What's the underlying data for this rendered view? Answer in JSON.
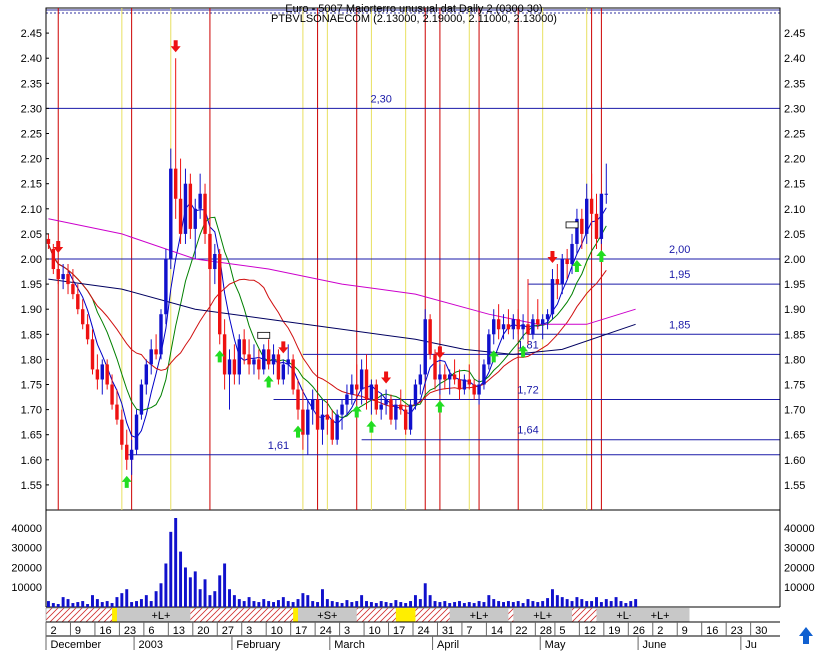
{
  "chart_data": {
    "type": "candlestick",
    "title_line1": "Euro - 5007 Maiorterro unusual dat Dally 2 (0300 30)",
    "title_line2": "PTBVLSONAECOM (2.13000, 2.19000, 2.11000, 2.13000)",
    "price_axis": {
      "min": 1.5,
      "max": 2.5,
      "ticks": [
        "2.45",
        "2.40",
        "2.35",
        "2.30",
        "2.25",
        "2.20",
        "2.15",
        "2.10",
        "2.05",
        "2.00",
        "1.95",
        "1.90",
        "1.85",
        "1.80",
        "1.75",
        "1.70",
        "1.65",
        "1.60",
        "1.55"
      ]
    },
    "volume_axis": {
      "min": 0,
      "max": 45000,
      "ticks": [
        "40000",
        "30000",
        "20000",
        "10000"
      ]
    },
    "x_ticks": [
      {
        "i": 0,
        "label": "2"
      },
      {
        "i": 5,
        "label": "9"
      },
      {
        "i": 10,
        "label": "16"
      },
      {
        "i": 15,
        "label": "23"
      },
      {
        "i": 20,
        "label": "6"
      },
      {
        "i": 25,
        "label": "13"
      },
      {
        "i": 30,
        "label": "20"
      },
      {
        "i": 35,
        "label": "27"
      },
      {
        "i": 40,
        "label": "3"
      },
      {
        "i": 45,
        "label": "10"
      },
      {
        "i": 50,
        "label": "17"
      },
      {
        "i": 55,
        "label": "24"
      },
      {
        "i": 60,
        "label": "3"
      },
      {
        "i": 65,
        "label": "10"
      },
      {
        "i": 70,
        "label": "17"
      },
      {
        "i": 75,
        "label": "24"
      },
      {
        "i": 80,
        "label": "31"
      },
      {
        "i": 85,
        "label": "7"
      },
      {
        "i": 90,
        "label": "14"
      },
      {
        "i": 95,
        "label": "22"
      },
      {
        "i": 100,
        "label": "28"
      },
      {
        "i": 104,
        "label": "5"
      },
      {
        "i": 109,
        "label": "12"
      },
      {
        "i": 114,
        "label": "19"
      },
      {
        "i": 119,
        "label": "26"
      },
      {
        "i": 124,
        "label": "2"
      },
      {
        "i": 129,
        "label": "9"
      },
      {
        "i": 134,
        "label": "16"
      },
      {
        "i": 139,
        "label": "23"
      },
      {
        "i": 144,
        "label": "30"
      }
    ],
    "month_labels": [
      {
        "i": 0,
        "label": "December"
      },
      {
        "i": 18,
        "label": "2003"
      },
      {
        "i": 38,
        "label": "February"
      },
      {
        "i": 58,
        "label": "March"
      },
      {
        "i": 79,
        "label": "April"
      },
      {
        "i": 101,
        "label": "May"
      },
      {
        "i": 121,
        "label": "June"
      },
      {
        "i": 142,
        "label": "Ju"
      }
    ],
    "level_lines": [
      {
        "value": 2.3,
        "label": "2,30",
        "label_i": 68
      },
      {
        "value": 2.0,
        "label": "2,00",
        "label_i": 129,
        "from_i": 0
      },
      {
        "value": 1.95,
        "label": "1,95",
        "label_i": 129,
        "from_i": 98
      },
      {
        "value": 1.85,
        "label": "1,85",
        "label_i": 129,
        "from_i": 98
      },
      {
        "value": 1.81,
        "label": "1,81",
        "label_i": 98,
        "from_i": 52
      },
      {
        "value": 1.72,
        "label": "1,72",
        "label_i": 98,
        "from_i": 46
      },
      {
        "value": 1.64,
        "label": "1,64",
        "label_i": 98,
        "from_i": 64
      },
      {
        "value": 1.61,
        "label": "1,61",
        "label_i": 47,
        "from_i": 16
      }
    ],
    "red_vlines": [
      2,
      17,
      33,
      55,
      63,
      77,
      80,
      88,
      96,
      111,
      113
    ],
    "yellow_vlines": [
      15,
      25,
      52,
      57,
      66,
      73,
      86,
      101,
      110
    ],
    "ohlc": [
      [
        2.04,
        2.05,
        2.02,
        2.03
      ],
      [
        2.02,
        2.03,
        1.97,
        1.98
      ],
      [
        1.98,
        2.0,
        1.95,
        1.96
      ],
      [
        1.96,
        1.99,
        1.94,
        1.97
      ],
      [
        1.97,
        1.99,
        1.93,
        1.95
      ],
      [
        1.95,
        1.98,
        1.92,
        1.93
      ],
      [
        1.93,
        1.95,
        1.89,
        1.9
      ],
      [
        1.9,
        1.92,
        1.86,
        1.87
      ],
      [
        1.87,
        1.89,
        1.83,
        1.84
      ],
      [
        1.84,
        1.86,
        1.77,
        1.78
      ],
      [
        1.78,
        1.81,
        1.74,
        1.76
      ],
      [
        1.76,
        1.8,
        1.73,
        1.79
      ],
      [
        1.79,
        1.8,
        1.74,
        1.75
      ],
      [
        1.75,
        1.77,
        1.7,
        1.71
      ],
      [
        1.71,
        1.74,
        1.67,
        1.68
      ],
      [
        1.68,
        1.7,
        1.62,
        1.63
      ],
      [
        1.63,
        1.66,
        1.58,
        1.6
      ],
      [
        1.6,
        1.64,
        1.57,
        1.62
      ],
      [
        1.62,
        1.7,
        1.61,
        1.69
      ],
      [
        1.69,
        1.76,
        1.68,
        1.75
      ],
      [
        1.75,
        1.8,
        1.73,
        1.79
      ],
      [
        1.79,
        1.84,
        1.77,
        1.82
      ],
      [
        1.82,
        1.85,
        1.8,
        1.81
      ],
      [
        1.81,
        1.9,
        1.8,
        1.89
      ],
      [
        1.89,
        2.02,
        1.87,
        2.0
      ],
      [
        2.0,
        2.22,
        1.98,
        2.18
      ],
      [
        2.18,
        2.4,
        2.08,
        2.12
      ],
      [
        2.12,
        2.2,
        2.03,
        2.05
      ],
      [
        2.05,
        2.18,
        2.03,
        2.15
      ],
      [
        2.15,
        2.17,
        2.04,
        2.06
      ],
      [
        2.06,
        2.12,
        2.0,
        2.1
      ],
      [
        2.1,
        2.17,
        2.08,
        2.13
      ],
      [
        2.13,
        2.15,
        2.03,
        2.05
      ],
      [
        2.05,
        2.1,
        1.97,
        1.98
      ],
      [
        1.98,
        2.03,
        1.95,
        2.01
      ],
      [
        2.01,
        2.02,
        1.83,
        1.85
      ],
      [
        1.85,
        1.88,
        1.74,
        1.77
      ],
      [
        1.77,
        1.82,
        1.7,
        1.8
      ],
      [
        1.8,
        1.83,
        1.75,
        1.77
      ],
      [
        1.77,
        1.85,
        1.75,
        1.84
      ],
      [
        1.84,
        1.86,
        1.79,
        1.81
      ],
      [
        1.81,
        1.84,
        1.77,
        1.79
      ],
      [
        1.79,
        1.83,
        1.77,
        1.8
      ],
      [
        1.8,
        1.82,
        1.76,
        1.78
      ],
      [
        1.78,
        1.83,
        1.77,
        1.82
      ],
      [
        1.82,
        1.84,
        1.78,
        1.79
      ],
      [
        1.79,
        1.83,
        1.77,
        1.81
      ],
      [
        1.81,
        1.82,
        1.75,
        1.76
      ],
      [
        1.76,
        1.8,
        1.75,
        1.79
      ],
      [
        1.79,
        1.83,
        1.77,
        1.8
      ],
      [
        1.8,
        1.81,
        1.73,
        1.74
      ],
      [
        1.74,
        1.76,
        1.68,
        1.7
      ],
      [
        1.7,
        1.74,
        1.62,
        1.65
      ],
      [
        1.65,
        1.72,
        1.61,
        1.7
      ],
      [
        1.7,
        1.74,
        1.67,
        1.72
      ],
      [
        1.72,
        1.73,
        1.64,
        1.66
      ],
      [
        1.66,
        1.72,
        1.63,
        1.69
      ],
      [
        1.69,
        1.72,
        1.65,
        1.68
      ],
      [
        1.68,
        1.7,
        1.63,
        1.64
      ],
      [
        1.64,
        1.7,
        1.63,
        1.69
      ],
      [
        1.69,
        1.72,
        1.66,
        1.71
      ],
      [
        1.71,
        1.75,
        1.69,
        1.73
      ],
      [
        1.73,
        1.77,
        1.71,
        1.75
      ],
      [
        1.75,
        1.79,
        1.72,
        1.74
      ],
      [
        1.74,
        1.8,
        1.71,
        1.78
      ],
      [
        1.78,
        1.81,
        1.7,
        1.72
      ],
      [
        1.72,
        1.76,
        1.69,
        1.75
      ],
      [
        1.75,
        1.76,
        1.69,
        1.7
      ],
      [
        1.7,
        1.73,
        1.68,
        1.71
      ],
      [
        1.71,
        1.74,
        1.69,
        1.72
      ],
      [
        1.72,
        1.73,
        1.67,
        1.68
      ],
      [
        1.68,
        1.72,
        1.66,
        1.71
      ],
      [
        1.71,
        1.74,
        1.69,
        1.7
      ],
      [
        1.7,
        1.71,
        1.65,
        1.66
      ],
      [
        1.66,
        1.72,
        1.65,
        1.71
      ],
      [
        1.71,
        1.76,
        1.7,
        1.75
      ],
      [
        1.75,
        1.79,
        1.73,
        1.77
      ],
      [
        1.77,
        1.9,
        1.76,
        1.88
      ],
      [
        1.88,
        1.89,
        1.8,
        1.81
      ],
      [
        1.81,
        1.82,
        1.74,
        1.76
      ],
      [
        1.76,
        1.79,
        1.73,
        1.77
      ],
      [
        1.77,
        1.79,
        1.74,
        1.76
      ],
      [
        1.76,
        1.78,
        1.73,
        1.77
      ],
      [
        1.77,
        1.8,
        1.75,
        1.76
      ],
      [
        1.76,
        1.78,
        1.72,
        1.74
      ],
      [
        1.74,
        1.77,
        1.73,
        1.76
      ],
      [
        1.76,
        1.79,
        1.74,
        1.75
      ],
      [
        1.75,
        1.76,
        1.72,
        1.73
      ],
      [
        1.73,
        1.76,
        1.71,
        1.75
      ],
      [
        1.75,
        1.8,
        1.74,
        1.79
      ],
      [
        1.79,
        1.86,
        1.78,
        1.85
      ],
      [
        1.85,
        1.9,
        1.83,
        1.88
      ],
      [
        1.88,
        1.91,
        1.84,
        1.86
      ],
      [
        1.86,
        1.89,
        1.84,
        1.87
      ],
      [
        1.87,
        1.9,
        1.85,
        1.86
      ],
      [
        1.86,
        1.89,
        1.84,
        1.88
      ],
      [
        1.88,
        1.9,
        1.85,
        1.86
      ],
      [
        1.86,
        1.89,
        1.84,
        1.87
      ],
      [
        1.87,
        1.96,
        1.83,
        1.85
      ],
      [
        1.85,
        1.89,
        1.84,
        1.88
      ],
      [
        1.88,
        1.92,
        1.86,
        1.87
      ],
      [
        1.87,
        1.89,
        1.84,
        1.88
      ],
      [
        1.88,
        1.9,
        1.86,
        1.89
      ],
      [
        1.89,
        1.98,
        1.88,
        1.96
      ],
      [
        1.96,
        1.99,
        1.92,
        1.95
      ],
      [
        1.95,
        2.01,
        1.93,
        2.0
      ],
      [
        2.0,
        2.02,
        1.96,
        1.99
      ],
      [
        1.99,
        2.05,
        1.97,
        2.03
      ],
      [
        2.03,
        2.1,
        2.01,
        2.08
      ],
      [
        2.08,
        2.1,
        2.02,
        2.05
      ],
      [
        2.05,
        2.15,
        2.03,
        2.12
      ],
      [
        2.12,
        2.17,
        2.06,
        2.09
      ],
      [
        2.09,
        2.13,
        2.02,
        2.04
      ],
      [
        2.04,
        2.12,
        2.03,
        2.13
      ],
      [
        2.13,
        2.19,
        2.11,
        2.13
      ]
    ],
    "volume": [
      3000,
      2000,
      1500,
      5000,
      4000,
      2000,
      2500,
      3000,
      1500,
      6000,
      4000,
      2500,
      3000,
      2000,
      5000,
      7000,
      9000,
      2500,
      3000,
      4000,
      6000,
      3000,
      8000,
      12000,
      22000,
      38000,
      45000,
      28000,
      20000,
      15000,
      18000,
      9000,
      14000,
      6000,
      8000,
      16000,
      22000,
      9000,
      6000,
      4000,
      3000,
      5000,
      3000,
      2500,
      4000,
      3000,
      2500,
      3500,
      5000,
      3000,
      2500,
      4000,
      7000,
      6000,
      3000,
      2500,
      9000,
      4000,
      3000,
      2500,
      2000,
      3500,
      2500,
      3000,
      6000,
      3000,
      2500,
      2000,
      3000,
      2500,
      2000,
      3500,
      2500,
      2000,
      3000,
      6000,
      4000,
      12000,
      6000,
      3000,
      2500,
      3000,
      2000,
      2500,
      3000,
      2000,
      2500,
      2000,
      3000,
      2500,
      6000,
      4000,
      3000,
      2500,
      3000,
      2500,
      3000,
      2000,
      4000,
      3000,
      2500,
      3000,
      4500,
      9000,
      6000,
      5000,
      4000,
      3000,
      5000,
      4000,
      3000,
      3000,
      5000,
      2500,
      4000,
      3000,
      5000,
      3000,
      2000,
      3000,
      4000
    ],
    "moving_averages": [
      {
        "name": "ma_short",
        "color": "#0000c8"
      },
      {
        "name": "ma_mid",
        "color": "#008000"
      },
      {
        "name": "ma_long",
        "color": "#d01010"
      },
      {
        "name": "ma_black",
        "color": "#000060"
      },
      {
        "name": "ma_magenta",
        "color": "#cc00cc"
      }
    ],
    "ma_magenta": [
      [
        0,
        2.08
      ],
      [
        15,
        2.05
      ],
      [
        30,
        2.0
      ],
      [
        45,
        1.98
      ],
      [
        60,
        1.95
      ],
      [
        75,
        1.93
      ],
      [
        90,
        1.89
      ],
      [
        100,
        1.87
      ],
      [
        110,
        1.87
      ],
      [
        120,
        1.9
      ]
    ],
    "ma_black": [
      [
        0,
        1.96
      ],
      [
        15,
        1.94
      ],
      [
        30,
        1.9
      ],
      [
        45,
        1.88
      ],
      [
        60,
        1.86
      ],
      [
        75,
        1.84
      ],
      [
        85,
        1.82
      ],
      [
        95,
        1.81
      ],
      [
        105,
        1.82
      ],
      [
        120,
        1.87
      ]
    ],
    "up_arrows": [
      16,
      35,
      45,
      51,
      63,
      66,
      80,
      91,
      97,
      108,
      113
    ],
    "down_arrows": [
      2,
      26,
      48,
      69,
      80,
      103,
      117,
      120
    ],
    "signal_boxes": [
      44,
      107,
      116
    ],
    "signal_strip": [
      {
        "i": 15,
        "kind": "yellow"
      },
      {
        "i": 16,
        "kind": "hatch"
      },
      {
        "i": 23,
        "kind": "text",
        "text": "+L+"
      },
      {
        "i": 52,
        "kind": "yellow"
      },
      {
        "i": 57,
        "kind": "text",
        "text": "+S+"
      },
      {
        "i": 73,
        "kind": "yellow"
      },
      {
        "i": 88,
        "kind": "text",
        "text": "+L+"
      },
      {
        "i": 101,
        "kind": "text",
        "text": "+L+"
      },
      {
        "i": 118,
        "kind": "text",
        "text": "+L+"
      },
      {
        "i": 125,
        "kind": "text",
        "text": "+L+"
      }
    ],
    "colors": {
      "up": "#1010cc",
      "down": "#ee1111",
      "level": "#1a1aa8",
      "vline_red": "#cc0000",
      "vline_yellow": "#e8e060",
      "grid": "#000000"
    }
  },
  "footer": {
    "scroll_arrow": "up-arrow-icon"
  }
}
